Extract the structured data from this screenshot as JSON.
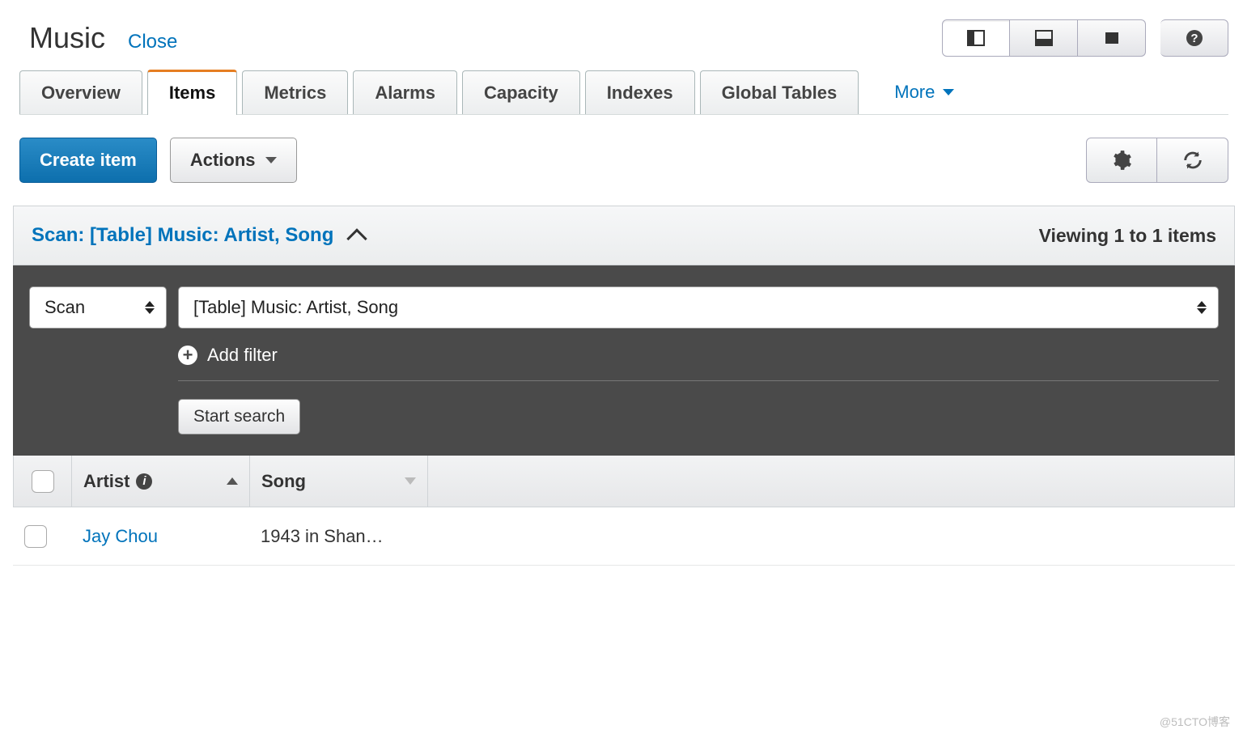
{
  "header": {
    "title": "Music",
    "close": "Close"
  },
  "view_toggles": {
    "mode1": "panel-left",
    "mode2": "panel-bottom",
    "mode3": "panel-full",
    "help": "help"
  },
  "tabs": [
    {
      "label": "Overview",
      "active": false
    },
    {
      "label": "Items",
      "active": true
    },
    {
      "label": "Metrics",
      "active": false
    },
    {
      "label": "Alarms",
      "active": false
    },
    {
      "label": "Capacity",
      "active": false
    },
    {
      "label": "Indexes",
      "active": false
    },
    {
      "label": "Global Tables",
      "active": false
    }
  ],
  "more_label": "More",
  "toolbar": {
    "create_item": "Create item",
    "actions": "Actions"
  },
  "scan": {
    "summary": "Scan: [Table] Music: Artist, Song",
    "viewing": "Viewing 1 to 1 items",
    "mode_select": "Scan",
    "table_select": "[Table] Music: Artist, Song",
    "add_filter": "Add filter",
    "start_search": "Start search"
  },
  "columns": {
    "artist": "Artist",
    "song": "Song"
  },
  "rows": [
    {
      "artist": "Jay Chou",
      "song": "1943 in Shan…"
    }
  ],
  "watermark": "@51CTO博客"
}
